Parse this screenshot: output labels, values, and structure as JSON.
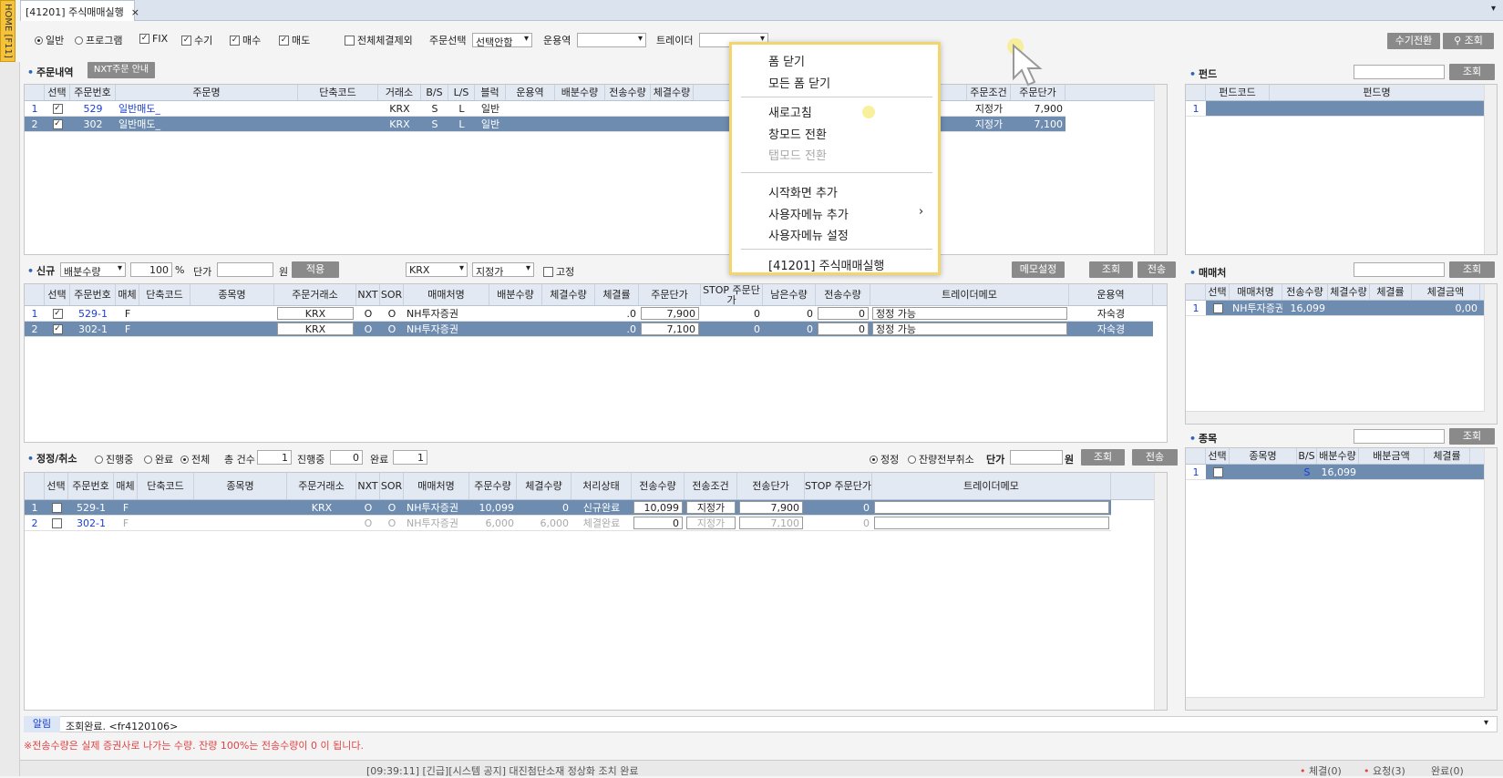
{
  "home_tab": "HOME [F11]",
  "tab": {
    "title": "[41201] 주식매매실행",
    "close": "×"
  },
  "toolbar": {
    "r1": "일반",
    "r2": "프로그램",
    "c1": "FIX",
    "c2": "수기",
    "c3": "매수",
    "c4": "매도",
    "c5": "전체체결제외",
    "order_sel_label": "주문선택",
    "order_sel_value": "선택안함",
    "fund_mgr_label": "운용역",
    "trader_label": "트레이더",
    "manual_btn": "수기전환",
    "search_btn": "조회"
  },
  "orders": {
    "title": "주문내역",
    "nxt_btn": "NXT주문 안내",
    "headers": [
      "선택",
      "주문번호",
      "주문명",
      "단축코드",
      "거래소",
      "B/S",
      "L/S",
      "블럭",
      "운용역",
      "배분수량",
      "전송수량",
      "체결수량",
      "주문조건",
      "주문단가"
    ],
    "rows": [
      {
        "n": "1",
        "no": "529",
        "name": "일반매도_",
        "ex": "KRX",
        "bs": "S",
        "ls": "L",
        "block": "일반",
        "cond": "지정가",
        "price": "7,900"
      },
      {
        "n": "2",
        "no": "302",
        "name": "일반매도_",
        "ex": "KRX",
        "bs": "S",
        "ls": "L",
        "block": "일반",
        "cond": "지정가",
        "price": "7,100"
      }
    ]
  },
  "fund": {
    "title": "펀드",
    "headers": [
      "펀드코드",
      "펀드명"
    ],
    "row": "1",
    "btn": "조회"
  },
  "newpanel": {
    "title": "신규",
    "dist_sel": "배분수량",
    "pct_value": "100",
    "pct_unit": "%",
    "price_label": "단가",
    "won": "원",
    "apply_btn": "적용",
    "ex_sel": "KRX",
    "cond_sel": "지정가",
    "fix_label": "고정",
    "memo_btn": "메모설정",
    "query_btn": "조회",
    "send_btn": "전송",
    "headers": [
      "선택",
      "주문번호",
      "매체",
      "단축코드",
      "종목명",
      "주문거래소",
      "NXT",
      "SOR",
      "매매처명",
      "배분수량",
      "체결수량",
      "체결률",
      "주문단가",
      "STOP 주문단가",
      "남은수량",
      "전송수량",
      "트레이더메모",
      "운용역"
    ],
    "rows": [
      {
        "n": "1",
        "no": "529-1",
        "media": "F",
        "ex": "KRX",
        "nxt": "O",
        "sor": "O",
        "broker": "NH투자증권",
        "rate": ".0",
        "price": "7,900",
        "stop": "0",
        "remain": "0",
        "send": "0",
        "memo": "정정 가능",
        "mgr": "자숙경"
      },
      {
        "n": "2",
        "no": "302-1",
        "media": "F",
        "ex": "KRX",
        "nxt": "O",
        "sor": "O",
        "broker": "NH투자증권",
        "rate": ".0",
        "price": "7,100",
        "stop": "0",
        "remain": "0",
        "send": "0",
        "memo": "정정 가능",
        "mgr": "자숙경"
      }
    ]
  },
  "broker": {
    "title": "매매처",
    "btn": "조회",
    "headers": [
      "선택",
      "매매처명",
      "전송수량",
      "체결수량",
      "체결률",
      "체결금액"
    ],
    "row": {
      "n": "1",
      "name": "NH투자증권",
      "qty": "16,099",
      "amt": "0,00"
    }
  },
  "amend": {
    "title": "정정/취소",
    "r1": "진행중",
    "r2": "완료",
    "r3": "전체",
    "total_label": "총 건수",
    "total": "1",
    "prog_label": "진행중",
    "prog": "0",
    "done_label": "완료",
    "done": "1",
    "r4": "정정",
    "r5": "잔량전부취소",
    "price_label": "단가",
    "won": "원",
    "query_btn": "조회",
    "send_btn": "전송",
    "headers": [
      "선택",
      "주문번호",
      "매체",
      "단축코드",
      "종목명",
      "주문거래소",
      "NXT",
      "SOR",
      "매매처명",
      "주문수량",
      "체결수량",
      "처리상태",
      "전송수량",
      "전송조건",
      "전송단가",
      "STOP 주문단가",
      "트레이더메모"
    ],
    "rows": [
      {
        "n": "1",
        "no": "529-1",
        "media": "F",
        "ex": "KRX",
        "nxt": "O",
        "sor": "O",
        "broker": "NH투자증권",
        "oqty": "10,099",
        "fqty": "0",
        "status": "신규완료",
        "sqty": "10,099",
        "scond": "지정가",
        "sprice": "7,900",
        "stop": "0"
      },
      {
        "n": "2",
        "no": "302-1",
        "media": "F",
        "ex": "",
        "nxt": "O",
        "sor": "O",
        "broker": "NH투자증권",
        "oqty": "6,000",
        "fqty": "6,000",
        "status": "체결완료",
        "sqty": "0",
        "scond": "지정가",
        "sprice": "7,100",
        "stop": "0"
      }
    ]
  },
  "stock": {
    "title": "종목",
    "btn": "조회",
    "headers": [
      "선택",
      "종목명",
      "B/S",
      "배분수량",
      "배분금액",
      "체결률"
    ],
    "row": {
      "n": "1",
      "bs": "S",
      "qty": "16,099"
    }
  },
  "alert": {
    "label": "알림",
    "text": "조회완료. <fr4120106>",
    "warn": "※전송수량은 실제 증권사로 나가는 수량. 잔량 100%는 전송수량이 0 이 됩니다."
  },
  "status": {
    "msg": "[09:39:11] [긴급][시스템 공지] 대진첨단소재 정상화 조치 완료",
    "s1": "체결(0)",
    "s2": "요청(3)",
    "s3": "완료(0)"
  },
  "context_menu": {
    "items": [
      "폼 닫기",
      "모든 폼 닫기",
      "새로고침",
      "창모드 전환",
      "탭모드 전환",
      "시작화면 추가",
      "사용자메뉴 추가",
      "사용자메뉴 설정",
      "[41201] 주식매매실행"
    ]
  }
}
